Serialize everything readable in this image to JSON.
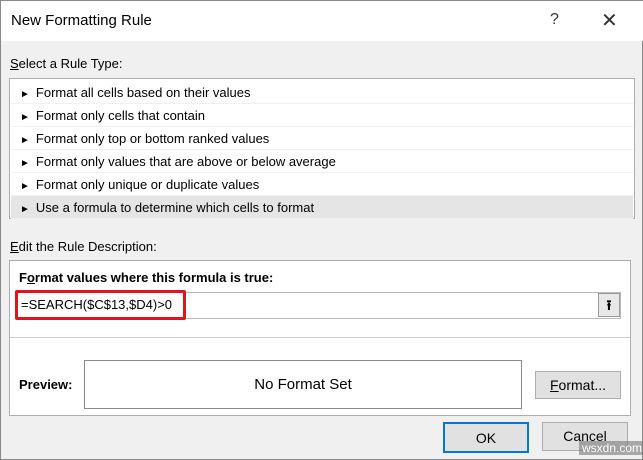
{
  "window": {
    "title": "New Formatting Rule",
    "help": "?",
    "close": "✕"
  },
  "rule_type": {
    "label_u": "S",
    "label_rest": "elect a Rule Type:",
    "arrow": "►",
    "items": [
      "Format all cells based on their values",
      "Format only cells that contain",
      "Format only top or bottom ranked values",
      "Format only values that are above or below average",
      "Format only unique or duplicate values",
      "Use a formula to determine which cells to format"
    ],
    "selected_index": 5
  },
  "description": {
    "label_u": "E",
    "label_rest": "dit the Rule Description:",
    "formula_label_a": "F",
    "formula_label_u": "o",
    "formula_label_rest": "rmat values where this formula is true:",
    "formula_value": "=SEARCH($C$13,$D4)>0",
    "upload_icon": "⭱"
  },
  "preview": {
    "label": "Preview:",
    "text": "No Format Set"
  },
  "buttons": {
    "format_u": "F",
    "format_rest": "ormat...",
    "ok": "OK",
    "cancel": "Cancel"
  },
  "watermark": "wsxdn.com",
  "highlight_color": "#e0141e"
}
